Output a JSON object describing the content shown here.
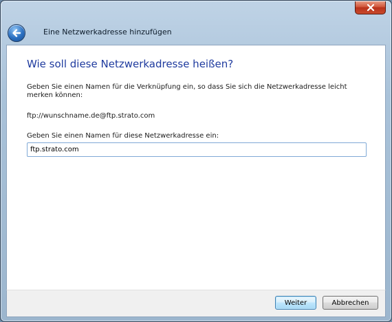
{
  "window": {
    "title": "Eine Netzwerkadresse hinzufügen",
    "close_icon": "close-icon",
    "back_icon": "back-arrow-icon"
  },
  "main": {
    "heading": "Wie soll diese Netzwerkadresse heißen?",
    "description": "Geben Sie einen Namen für die Verknüpfung ein, so dass Sie sich die Netzwerkadresse leicht merken können:",
    "address": "ftp://wunschname.de@ftp.strato.com",
    "name_label": "Geben Sie einen Namen für diese Netzwerkadresse ein:",
    "name_value": "ftp.strato.com"
  },
  "footer": {
    "next_label": "Weiter",
    "cancel_label": "Abbrechen"
  },
  "colors": {
    "heading": "#1e3a9e",
    "close_button": "#c94a2c",
    "back_button": "#2a6fc0"
  }
}
